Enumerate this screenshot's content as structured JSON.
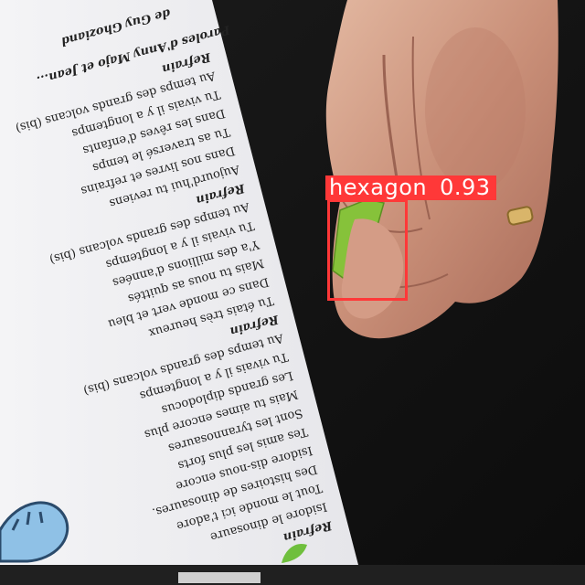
{
  "song_sheet": {
    "credit": "Paroles d'Anny Majo et Jean...",
    "credit2": "de Guy Ghoziand",
    "verses": [
      "Refrain",
      "Au temps des grands volcans (bis)",
      "Tu vivais il y a longtemps",
      "Dans les rêves d'enfants",
      "Tu as traversé le temps",
      "Dans nos livres et refrains",
      "Aujourd'hui tu reviens",
      "Refrain",
      "Au temps des grands volcans (bis)",
      "Tu vivais il y a longtemps",
      "Y'a des millions d'années",
      "Mais tu nous as quittés",
      "Dans ce monde vert et bleu",
      "Tu étais très heureux",
      "Refrain",
      "Au temps des grands volcans (bis)",
      "Tu vivais il y a longtemps",
      "Les grands diplodocus",
      "Mais tu aimes encore plus",
      "Sont les tyrannosaures",
      "Tes amis les plus forts",
      "Isidore dis-nous encore",
      "Des histoires de dinosaures.",
      "Tout le monde ici t'adore",
      "Isidore le dinosaure",
      "Refrain"
    ]
  },
  "detection": {
    "label": "hexagon",
    "score": "0.93",
    "box_color": "#ff3838"
  }
}
